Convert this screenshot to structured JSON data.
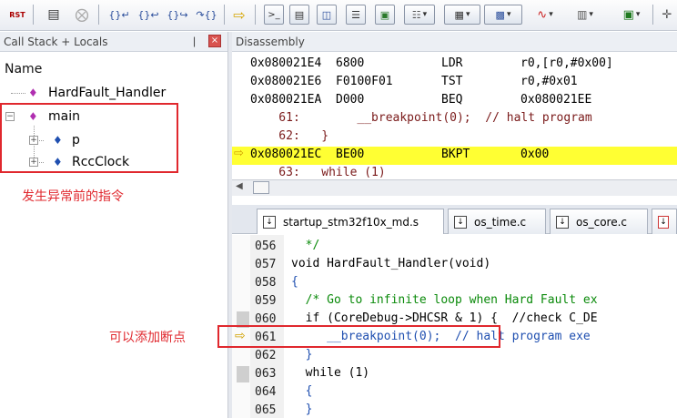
{
  "toolbar": {
    "rst_label": "RST",
    "step_labels": [
      "{}",
      "{}",
      "{}",
      "{}"
    ],
    "icons": [
      "reset-icon",
      "step-into-icon",
      "stop-icon",
      "step-over-icon",
      "step-out-icon",
      "step-in-icon",
      "run-to-cursor-icon",
      "show-next-statement-icon",
      "command-window-icon",
      "disassembly-window-icon",
      "symbols-window-icon",
      "registers-window-icon",
      "call-stack-icon",
      "watch-window-icon",
      "memory-window-icon",
      "serial-window-icon",
      "analysis-window-icon",
      "trace-window-icon",
      "system-viewer-icon",
      "toolbox-icon"
    ]
  },
  "left_panel": {
    "title": "Call Stack + Locals",
    "pin": "❘",
    "close": "×",
    "column_header": "Name",
    "tree": [
      {
        "label": "HardFault_Handler",
        "level": 0,
        "expander": ""
      },
      {
        "label": "main",
        "level": 0,
        "expander": "−"
      },
      {
        "label": "p",
        "level": 1,
        "expander": "+"
      },
      {
        "label": "RccClock",
        "level": 1,
        "expander": "+"
      }
    ],
    "annotation": "发生异常前的指令"
  },
  "disassembly": {
    "title": "Disassembly",
    "lines": [
      {
        "addr": "0x080021E4",
        "code": "6800",
        "mnemonic": "LDR",
        "operand": "r0,[r0,#0x00]"
      },
      {
        "addr": "0x080021E6",
        "code": "F0100F01",
        "mnemonic": "TST",
        "operand": "r0,#0x01"
      },
      {
        "addr": "0x080021EA",
        "code": "D000",
        "mnemonic": "BEQ",
        "operand": "0x080021EE"
      },
      {
        "source": "    61:        __breakpoint(0);  // halt program"
      },
      {
        "source": "    62:   }"
      },
      {
        "addr": "0x080021EC",
        "code": "BE00",
        "mnemonic": "BKPT",
        "operand": "0x00",
        "current": true
      },
      {
        "source": "    63:   while (1)"
      }
    ]
  },
  "tabs": [
    {
      "label": "startup_stm32f10x_md.s",
      "active": true
    },
    {
      "label": "os_time.c",
      "active": false
    },
    {
      "label": "os_core.c",
      "active": false
    },
    {
      "label": "",
      "active": false
    }
  ],
  "editor": {
    "lines": [
      {
        "num": "056",
        "text": "  */"
      },
      {
        "num": "057",
        "text": "void HardFault_Handler(void)"
      },
      {
        "num": "058",
        "text": "{"
      },
      {
        "num": "059",
        "text": "  /* Go to infinite loop when Hard Fault ex"
      },
      {
        "num": "060",
        "text": "  if (CoreDebug->DHCSR & 1) {  //check C_DE"
      },
      {
        "num": "061",
        "text": "     __breakpoint(0);  // halt program exe"
      },
      {
        "num": "062",
        "text": "  }"
      },
      {
        "num": "063",
        "text": "  while (1)"
      },
      {
        "num": "064",
        "text": "  {"
      },
      {
        "num": "065",
        "text": "  }"
      }
    ],
    "annotation": "可以添加断点"
  }
}
